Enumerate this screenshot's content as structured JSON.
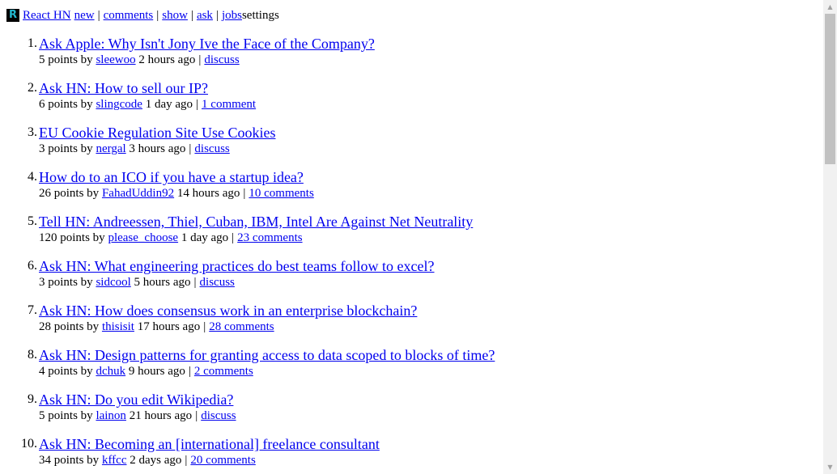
{
  "header": {
    "logo_letter": "R",
    "brand": "React HN",
    "nav": [
      "new",
      "comments",
      "show",
      "ask",
      "jobs"
    ],
    "separator": "|",
    "settings": "settings"
  },
  "stories": [
    {
      "rank": "1.",
      "title": "Ask Apple: Why Isn't Jony Ive the Face of the Company?",
      "points": "5 points by",
      "user": "sleewoo",
      "age": "2 hours ago",
      "comments": "discuss"
    },
    {
      "rank": "2.",
      "title": "Ask HN: How to sell our IP?",
      "points": "6 points by",
      "user": "slingcode",
      "age": "1 day ago",
      "comments": "1 comment"
    },
    {
      "rank": "3.",
      "title": "EU Cookie Regulation Site Use Cookies",
      "points": "3 points by",
      "user": "nergal",
      "age": "3 hours ago",
      "comments": "discuss"
    },
    {
      "rank": "4.",
      "title": "How do to an ICO if you have a startup idea?",
      "points": "26 points by",
      "user": "FahadUddin92",
      "age": "14 hours ago",
      "comments": "10 comments"
    },
    {
      "rank": "5.",
      "title": "Tell HN: Andreessen, Thiel, Cuban, IBM, Intel Are Against Net Neutrality",
      "points": "120 points by",
      "user": "please_choose",
      "age": "1 day ago",
      "comments": "23 comments"
    },
    {
      "rank": "6.",
      "title": "Ask HN: What engineering practices do best teams follow to excel?",
      "points": "3 points by",
      "user": "sidcool",
      "age": "5 hours ago",
      "comments": "discuss"
    },
    {
      "rank": "7.",
      "title": "Ask HN: How does consensus work in an enterprise blockchain?",
      "points": "28 points by",
      "user": "thisisit",
      "age": "17 hours ago",
      "comments": "28 comments"
    },
    {
      "rank": "8.",
      "title": "Ask HN: Design patterns for granting access to data scoped to blocks of time?",
      "points": "4 points by",
      "user": "dchuk",
      "age": "9 hours ago",
      "comments": "2 comments"
    },
    {
      "rank": "9.",
      "title": "Ask HN: Do you edit Wikipedia?",
      "points": "5 points by",
      "user": "lainon",
      "age": "21 hours ago",
      "comments": "discuss"
    },
    {
      "rank": "10.",
      "title": "Ask HN: Becoming an [international] freelance consultant",
      "points": "34 points by",
      "user": "kffcc",
      "age": "2 days ago",
      "comments": "20 comments"
    }
  ],
  "meta_separator": "|",
  "icons": {
    "scroll_up": "scroll-up-arrow-icon",
    "scroll_down": "scroll-down-arrow-icon"
  },
  "colors": {
    "link": "#0000ee",
    "logo_bg": "#000000",
    "logo_fg": "#22b8cf",
    "scrollbar_track": "#f1f1f1",
    "scrollbar_thumb": "#c1c1c1"
  }
}
